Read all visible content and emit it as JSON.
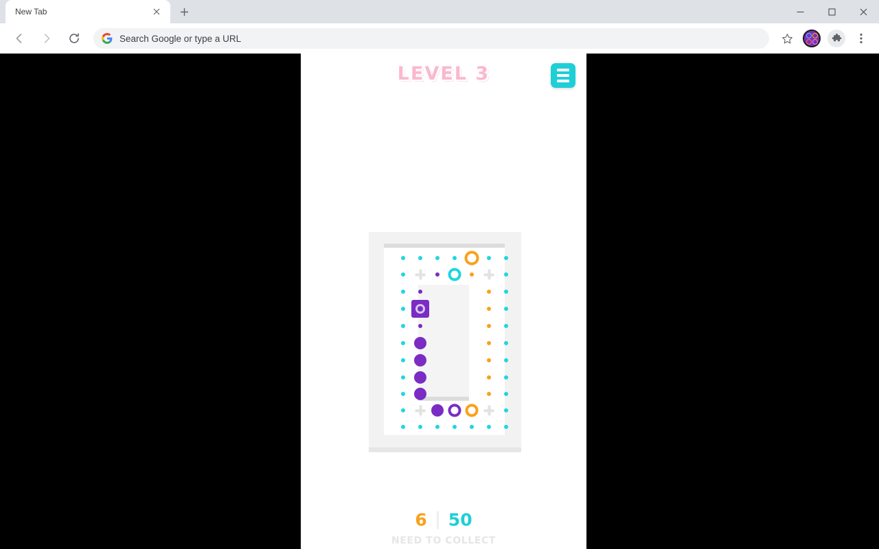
{
  "browser": {
    "tab": {
      "title": "New Tab",
      "close_icon": "close-icon"
    },
    "new_tab_icon": "plus-icon",
    "window_controls": {
      "minimize": "—",
      "maximize": "❐",
      "close": "✕"
    },
    "nav": {
      "back": "←",
      "forward": "→",
      "reload": "⟳"
    },
    "omnibox": {
      "placeholder": "Search Google or type a URL",
      "value": "",
      "search_engine_icon": "google-g-icon"
    },
    "actions": {
      "bookmark_icon": "star-icon",
      "profile_icon": "profile-avatar-icon",
      "extensions_icon": "puzzle-piece-icon",
      "menu_icon": "three-dot-menu-icon"
    }
  },
  "game": {
    "header": {
      "level_label": "LEVEL 3",
      "menu_icon": "hamburger-menu-icon"
    },
    "footer": {
      "collected": "6",
      "divider": "|",
      "total": "50",
      "caption": "NEED TO COLLECT"
    },
    "colors": {
      "cyan": "#1ed6e0",
      "orange": "#f9a11b",
      "purple": "#7b2cc4",
      "plus_gray": "#e2e2e2",
      "pink_title": "#f9b9cd",
      "board_bg": "#f2f2f2",
      "panel_bg": "#f4f4f4"
    },
    "board": {
      "columns": 7,
      "rows": 11,
      "col_x": [
        50,
        75,
        100,
        125,
        150,
        175,
        200
      ],
      "row_y": [
        38,
        62,
        87,
        112,
        137,
        162,
        187,
        212,
        236,
        260,
        284
      ],
      "tokens": [
        {
          "name": "dot-cyan-small",
          "col": 1,
          "row": 1,
          "kind": "dot-sm",
          "color": "#1ed6e0"
        },
        {
          "name": "dot-cyan-small",
          "col": 2,
          "row": 1,
          "kind": "dot-sm",
          "color": "#1ed6e0"
        },
        {
          "name": "dot-cyan-small",
          "col": 3,
          "row": 1,
          "kind": "dot-sm",
          "color": "#1ed6e0"
        },
        {
          "name": "dot-cyan-small",
          "col": 4,
          "row": 1,
          "kind": "dot-sm",
          "color": "#1ed6e0"
        },
        {
          "name": "ring-orange",
          "col": 5,
          "row": 1,
          "kind": "ring-lg",
          "color": "#f9a11b"
        },
        {
          "name": "dot-cyan-small",
          "col": 6,
          "row": 1,
          "kind": "dot-sm",
          "color": "#1ed6e0"
        },
        {
          "name": "dot-cyan-small",
          "col": 7,
          "row": 1,
          "kind": "dot-sm",
          "color": "#1ed6e0"
        },
        {
          "name": "dot-cyan-small",
          "col": 1,
          "row": 2,
          "kind": "dot-sm",
          "color": "#1ed6e0"
        },
        {
          "name": "plus-marker",
          "col": 2,
          "row": 2,
          "kind": "plus",
          "color": "#e2e2e2"
        },
        {
          "name": "dot-purple-small",
          "col": 3,
          "row": 2,
          "kind": "dot-sm",
          "color": "#7b2cc4"
        },
        {
          "name": "ring-cyan",
          "col": 4,
          "row": 2,
          "kind": "ring-md",
          "color": "#1ed6e0"
        },
        {
          "name": "dot-orange-small",
          "col": 5,
          "row": 2,
          "kind": "dot-sm",
          "color": "#f9a11b"
        },
        {
          "name": "plus-marker",
          "col": 6,
          "row": 2,
          "kind": "plus",
          "color": "#e2e2e2"
        },
        {
          "name": "dot-cyan-small",
          "col": 7,
          "row": 2,
          "kind": "dot-sm",
          "color": "#1ed6e0"
        },
        {
          "name": "dot-cyan-small",
          "col": 1,
          "row": 3,
          "kind": "dot-sm",
          "color": "#1ed6e0"
        },
        {
          "name": "dot-purple-small",
          "col": 2,
          "row": 3,
          "kind": "dot-sm",
          "color": "#7b2cc4"
        },
        {
          "name": "dot-orange-small",
          "col": 6,
          "row": 3,
          "kind": "dot-sm",
          "color": "#f9a11b"
        },
        {
          "name": "dot-cyan-small",
          "col": 7,
          "row": 3,
          "kind": "dot-sm",
          "color": "#1ed6e0"
        },
        {
          "name": "dot-cyan-small",
          "col": 1,
          "row": 4,
          "kind": "dot-sm",
          "color": "#1ed6e0"
        },
        {
          "name": "square-purple-ring",
          "col": 2,
          "row": 4,
          "kind": "square",
          "color": "#7b2cc4"
        },
        {
          "name": "dot-orange-small",
          "col": 6,
          "row": 4,
          "kind": "dot-sm",
          "color": "#f9a11b"
        },
        {
          "name": "dot-cyan-small",
          "col": 7,
          "row": 4,
          "kind": "dot-sm",
          "color": "#1ed6e0"
        },
        {
          "name": "dot-cyan-small",
          "col": 1,
          "row": 5,
          "kind": "dot-sm",
          "color": "#1ed6e0"
        },
        {
          "name": "dot-purple-small",
          "col": 2,
          "row": 5,
          "kind": "dot-sm",
          "color": "#7b2cc4"
        },
        {
          "name": "dot-orange-small",
          "col": 6,
          "row": 5,
          "kind": "dot-sm",
          "color": "#f9a11b"
        },
        {
          "name": "dot-cyan-small",
          "col": 7,
          "row": 5,
          "kind": "dot-sm",
          "color": "#1ed6e0"
        },
        {
          "name": "dot-cyan-small",
          "col": 1,
          "row": 6,
          "kind": "dot-sm",
          "color": "#1ed6e0"
        },
        {
          "name": "dot-purple-large",
          "col": 2,
          "row": 6,
          "kind": "dot-lg",
          "color": "#7b2cc4"
        },
        {
          "name": "dot-orange-small",
          "col": 6,
          "row": 6,
          "kind": "dot-sm",
          "color": "#f9a11b"
        },
        {
          "name": "dot-cyan-small",
          "col": 7,
          "row": 6,
          "kind": "dot-sm",
          "color": "#1ed6e0"
        },
        {
          "name": "dot-cyan-small",
          "col": 1,
          "row": 7,
          "kind": "dot-sm",
          "color": "#1ed6e0"
        },
        {
          "name": "dot-purple-large",
          "col": 2,
          "row": 7,
          "kind": "dot-lg",
          "color": "#7b2cc4"
        },
        {
          "name": "dot-orange-small",
          "col": 6,
          "row": 7,
          "kind": "dot-sm",
          "color": "#f9a11b"
        },
        {
          "name": "dot-cyan-small",
          "col": 7,
          "row": 7,
          "kind": "dot-sm",
          "color": "#1ed6e0"
        },
        {
          "name": "dot-cyan-small",
          "col": 1,
          "row": 8,
          "kind": "dot-sm",
          "color": "#1ed6e0"
        },
        {
          "name": "dot-purple-large",
          "col": 2,
          "row": 8,
          "kind": "dot-lg",
          "color": "#7b2cc4"
        },
        {
          "name": "dot-orange-small",
          "col": 6,
          "row": 8,
          "kind": "dot-sm",
          "color": "#f9a11b"
        },
        {
          "name": "dot-cyan-small",
          "col": 7,
          "row": 8,
          "kind": "dot-sm",
          "color": "#1ed6e0"
        },
        {
          "name": "dot-cyan-small",
          "col": 1,
          "row": 9,
          "kind": "dot-sm",
          "color": "#1ed6e0"
        },
        {
          "name": "dot-purple-large",
          "col": 2,
          "row": 9,
          "kind": "dot-lg",
          "color": "#7b2cc4"
        },
        {
          "name": "dot-orange-small",
          "col": 6,
          "row": 9,
          "kind": "dot-sm",
          "color": "#f9a11b"
        },
        {
          "name": "dot-cyan-small",
          "col": 7,
          "row": 9,
          "kind": "dot-sm",
          "color": "#1ed6e0"
        },
        {
          "name": "dot-cyan-small",
          "col": 1,
          "row": 10,
          "kind": "dot-sm",
          "color": "#1ed6e0"
        },
        {
          "name": "plus-marker",
          "col": 2,
          "row": 10,
          "kind": "plus",
          "color": "#e2e2e2"
        },
        {
          "name": "dot-purple-large",
          "col": 3,
          "row": 10,
          "kind": "dot-lg",
          "color": "#7b2cc4"
        },
        {
          "name": "ring-purple",
          "col": 4,
          "row": 10,
          "kind": "ring-md",
          "color": "#7b2cc4"
        },
        {
          "name": "ring-orange",
          "col": 5,
          "row": 10,
          "kind": "ring-md",
          "color": "#f9a11b"
        },
        {
          "name": "plus-marker",
          "col": 6,
          "row": 10,
          "kind": "plus",
          "color": "#e2e2e2"
        },
        {
          "name": "dot-cyan-small",
          "col": 7,
          "row": 10,
          "kind": "dot-sm",
          "color": "#1ed6e0"
        },
        {
          "name": "dot-cyan-small",
          "col": 1,
          "row": 11,
          "kind": "dot-sm",
          "color": "#1ed6e0"
        },
        {
          "name": "dot-cyan-small",
          "col": 2,
          "row": 11,
          "kind": "dot-sm",
          "color": "#1ed6e0"
        },
        {
          "name": "dot-cyan-small",
          "col": 3,
          "row": 11,
          "kind": "dot-sm",
          "color": "#1ed6e0"
        },
        {
          "name": "dot-cyan-small",
          "col": 4,
          "row": 11,
          "kind": "dot-sm",
          "color": "#1ed6e0"
        },
        {
          "name": "dot-cyan-small",
          "col": 5,
          "row": 11,
          "kind": "dot-sm",
          "color": "#1ed6e0"
        },
        {
          "name": "dot-cyan-small",
          "col": 6,
          "row": 11,
          "kind": "dot-sm",
          "color": "#1ed6e0"
        },
        {
          "name": "dot-cyan-small",
          "col": 7,
          "row": 11,
          "kind": "dot-sm",
          "color": "#1ed6e0"
        }
      ]
    }
  }
}
